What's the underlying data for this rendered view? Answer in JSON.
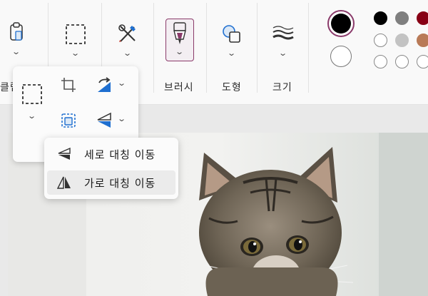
{
  "ribbon": {
    "groups": {
      "clipboard": "클립",
      "brushes": "브러시",
      "shapes": "도형",
      "size": "크기"
    }
  },
  "image_menu": {
    "rotate_chevron": "⌄",
    "flip_chevron": "⌄",
    "select_chevron": "⌄"
  },
  "flip_menu": {
    "items": [
      {
        "label": "세로 대칭 이동",
        "selected": false
      },
      {
        "label": "가로 대칭 이동",
        "selected": true
      }
    ]
  },
  "colors": {
    "primary": "#000000",
    "secondary": "#ffffff",
    "accent": "#8a3a6a",
    "palette": [
      "#000000",
      "#7f7f7f",
      "#880015",
      "#ffffff",
      "#c3c3c3",
      "#b97a57",
      "#ffffff",
      "#ffffff",
      "#ffffff"
    ]
  },
  "icons": [
    "clipboard-icon",
    "selection-icon",
    "tools-icon",
    "brush-icon",
    "shapes-icon",
    "stroke-size-icon",
    "crop-icon",
    "rotate-icon",
    "resize-icon",
    "flip-icon",
    "flip-vertical-icon",
    "flip-horizontal-icon"
  ]
}
